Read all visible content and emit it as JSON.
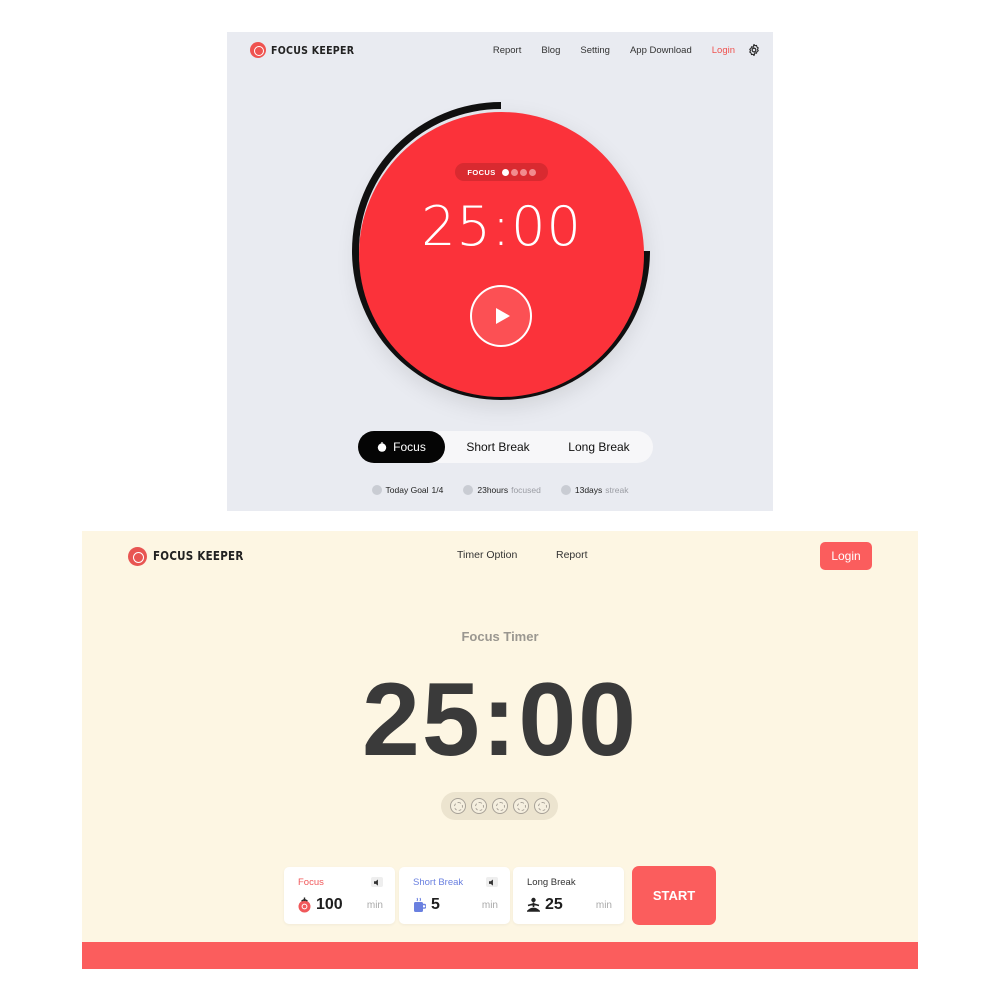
{
  "top": {
    "brand": "FOCUS KEEPER",
    "nav": [
      "Report",
      "Blog",
      "Setting",
      "App Download",
      "Login"
    ],
    "settings_icon": "gear-icon",
    "accent": "#fb323a",
    "timer": {
      "chip_label": "FOCUS",
      "time": "25:00",
      "play_icon": "play-icon"
    },
    "modes": {
      "focus": "Focus",
      "short_break": "Short Break",
      "long_break": "Long Break",
      "active": "Focus"
    },
    "stats": {
      "goal_label": "Today Goal",
      "goal_value": "1/4",
      "hours_value": "23hours",
      "hours_label": "focused",
      "streak_value": "13days",
      "streak_label": "streak"
    }
  },
  "bottom": {
    "brand": "FOCUS KEEPER",
    "nav": {
      "timer_option": "Timer Option",
      "report": "Report"
    },
    "login": "Login",
    "accent": "#fb5d5d",
    "background": "#fdf6e3",
    "title": "Focus Timer",
    "time": "25:00",
    "session_count": 5,
    "cards": [
      {
        "label": "Focus",
        "value": "100",
        "unit": "min",
        "icon": "tomato-icon",
        "color": "#f0585a"
      },
      {
        "label": "Short Break",
        "value": "5",
        "unit": "min",
        "icon": "coffee-cup-icon",
        "color": "#6a80e0"
      },
      {
        "label": "Long Break",
        "value": "25",
        "unit": "min",
        "icon": "meditation-icon",
        "color": "#222222"
      }
    ],
    "start": "START"
  }
}
